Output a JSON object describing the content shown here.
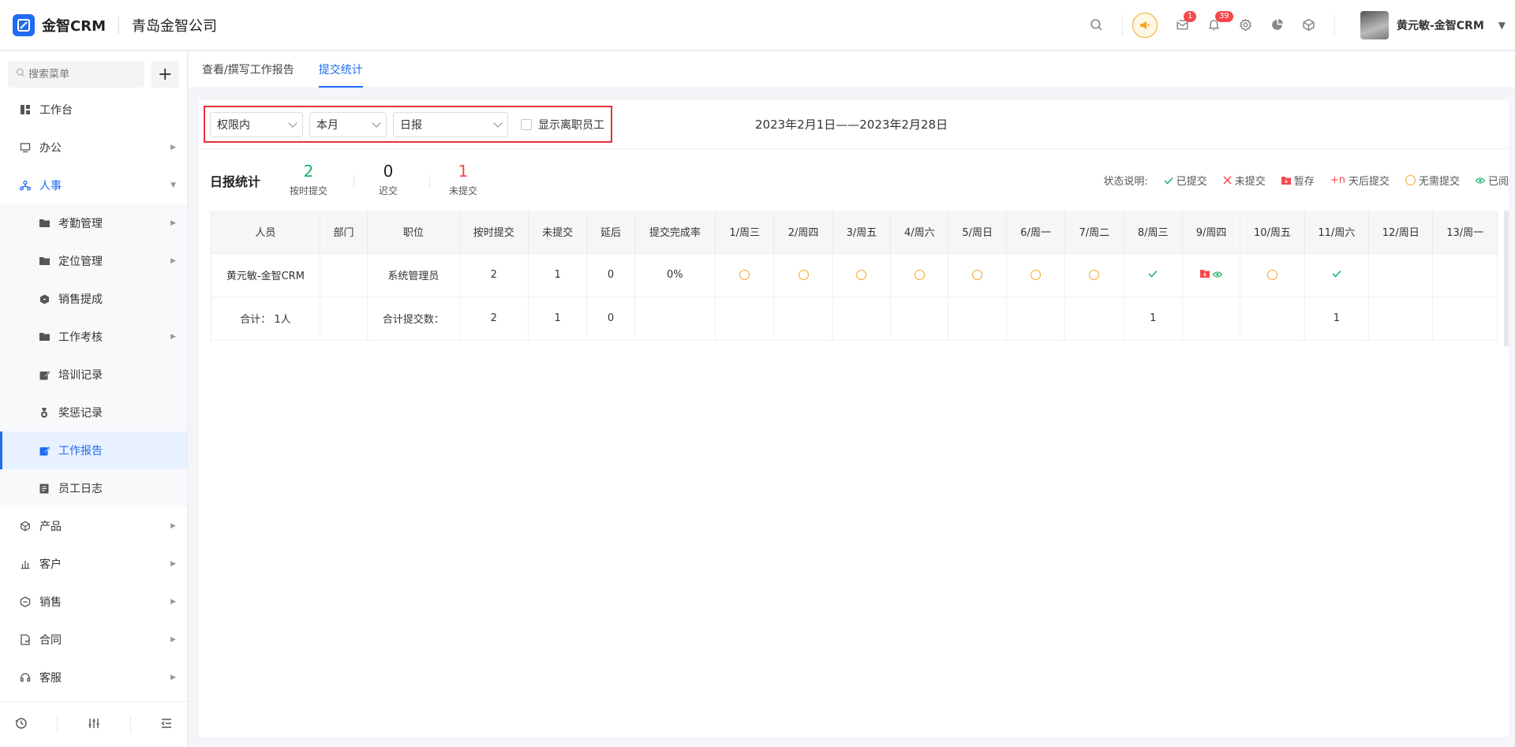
{
  "header": {
    "logo_text": "金智CRM",
    "company": "青岛金智公司",
    "message_badge": "1",
    "notice_badge": "39",
    "user_name": "黄元敏-金智CRM",
    "icons": [
      "search-icon",
      "horn-icon",
      "message-icon",
      "bell-icon",
      "gear-icon",
      "pie-chart-icon",
      "cube-icon"
    ]
  },
  "sidebar": {
    "search_placeholder": "搜索菜单",
    "add_label": "+",
    "items": [
      {
        "label": "工作台",
        "icon": "dashboard-icon"
      },
      {
        "label": "办公",
        "icon": "monitor-icon"
      },
      {
        "label": "人事",
        "icon": "org-icon"
      },
      {
        "label": "产品",
        "icon": "box-icon"
      },
      {
        "label": "客户",
        "icon": "bar-icon"
      },
      {
        "label": "销售",
        "icon": "hex-icon"
      },
      {
        "label": "合同",
        "icon": "contract-icon"
      },
      {
        "label": "客服",
        "icon": "headset-icon"
      }
    ],
    "sub_items": [
      {
        "label": "考勤管理"
      },
      {
        "label": "定位管理"
      },
      {
        "label": "销售提成"
      },
      {
        "label": "工作考核"
      },
      {
        "label": "培训记录"
      },
      {
        "label": "奖惩记录"
      },
      {
        "label": "工作报告"
      },
      {
        "label": "员工日志"
      }
    ]
  },
  "tabs": [
    {
      "label": "查看/撰写工作报告",
      "active": false
    },
    {
      "label": "提交统计",
      "active": true
    }
  ],
  "filters": {
    "scope": "权限内",
    "period": "本月",
    "report_type": "日报",
    "show_resigned_label": "显示离职员工",
    "date_range": "2023年2月1日——2023年2月28日"
  },
  "stats": {
    "title": "日报统计",
    "on_time": {
      "value": "2",
      "label": "按时提交"
    },
    "late": {
      "value": "0",
      "label": "迟交"
    },
    "missing": {
      "value": "1",
      "label": "未提交"
    }
  },
  "legend": {
    "title": "状态说明:",
    "items": [
      {
        "label": "已提交"
      },
      {
        "label": "未提交"
      },
      {
        "label": "暂存"
      },
      {
        "prefix": "+n",
        "label": "天后提交"
      },
      {
        "label": "无需提交"
      },
      {
        "label": "已阅"
      }
    ]
  },
  "table": {
    "headers": [
      "人员",
      "部门",
      "职位",
      "按时提交",
      "未提交",
      "延后",
      "提交完成率",
      "1/周三",
      "2/周四",
      "3/周五",
      "4/周六",
      "5/周日",
      "6/周一",
      "7/周二",
      "8/周三",
      "9/周四",
      "10/周五",
      "11/周六",
      "12/周日",
      "13/周一"
    ],
    "row": {
      "person": "黄元敏-金智CRM",
      "dept": "",
      "position": "系统管理员",
      "on_time": "2",
      "missing": "1",
      "delayed": "0",
      "rate": "0%",
      "days": [
        "none",
        "none",
        "none",
        "none",
        "none",
        "none",
        "none",
        "submitted",
        "draft-read",
        "none",
        "submitted",
        "",
        ""
      ]
    },
    "total": {
      "label": "合计： 1人",
      "sub_label": "合计提交数：",
      "on_time": "2",
      "missing": "1",
      "delayed": "0",
      "days": [
        "",
        "",
        "",
        "",
        "",
        "",
        "",
        "1",
        "",
        "",
        "1",
        "",
        ""
      ]
    }
  },
  "colors": {
    "brand": "#1f6bf2",
    "on_time": "#17b26a",
    "missing": "#f5484a",
    "none_needed": "#f5a623",
    "highlight_box": "#e8313a"
  }
}
